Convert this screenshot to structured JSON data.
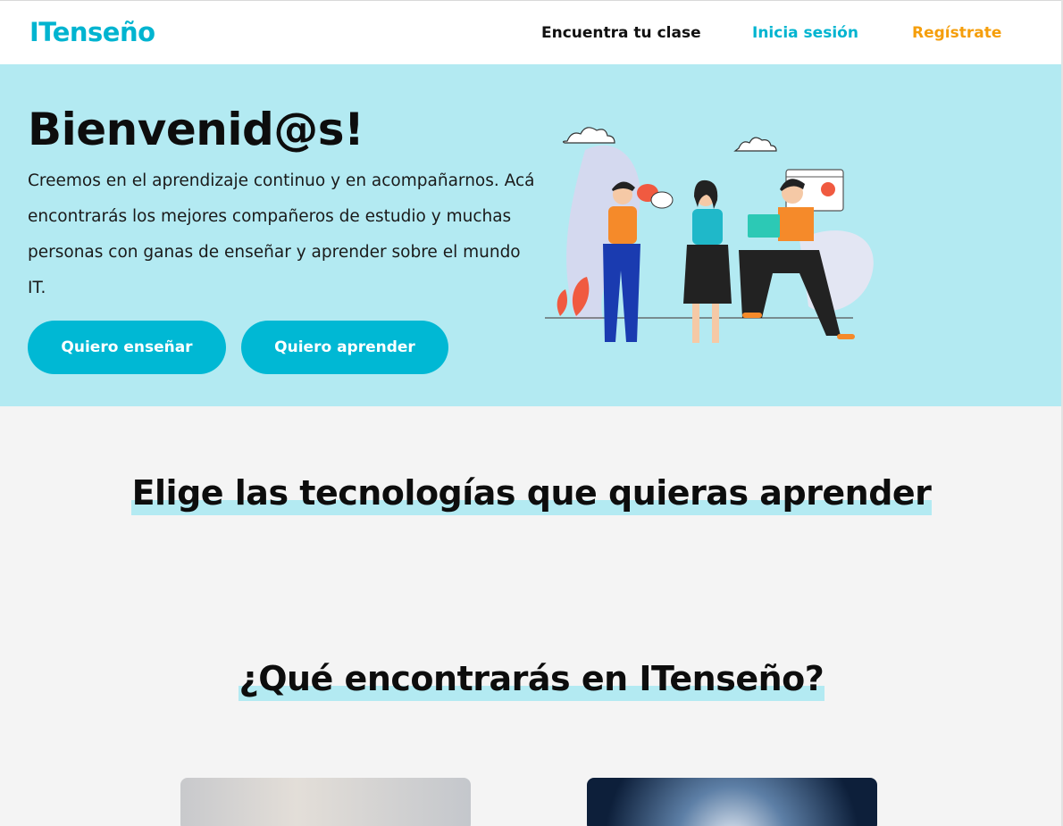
{
  "header": {
    "logo": "ITenseño",
    "nav": {
      "find_class": "Encuentra tu clase",
      "login": "Inicia sesión",
      "register": "Regístrate"
    }
  },
  "hero": {
    "title": "Bienvenid@s!",
    "description": "Creemos en el aprendizaje continuo y en acompañarnos. Acá encontrarás los mejores compañeros de estudio y muchas personas con ganas de enseñar y aprender sobre el mundo IT.",
    "buttons": {
      "teach": "Quiero enseñar",
      "learn": "Quiero aprender"
    }
  },
  "sections": {
    "technologies_title": "Elige las tecnologías que quieras aprender",
    "features_title": "¿Qué encontrarás en ITenseño?"
  },
  "colors": {
    "brand": "#00b4d0",
    "hero_bg": "#b3eaf2",
    "register": "#f59e0b",
    "button": "#00b8d4"
  }
}
